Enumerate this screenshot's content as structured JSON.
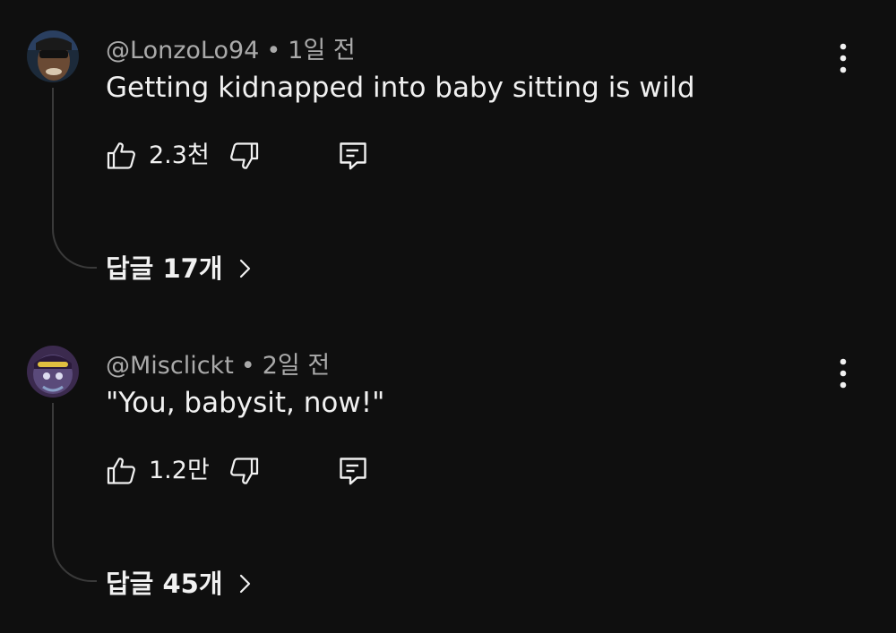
{
  "comments": [
    {
      "author": "@LonzoLo94",
      "separator": "•",
      "time": "1일 전",
      "text": "Getting kidnapped into baby sitting is wild",
      "likes": "2.3천",
      "replies_label": "답글 17개",
      "icons": {
        "like": "thumb-up-icon",
        "dislike": "thumb-down-icon",
        "reply": "comment-reply-icon",
        "more": "more-vert-icon",
        "chevron": "chevron-right-icon"
      }
    },
    {
      "author": "@Misclickt",
      "separator": "•",
      "time": "2일 전",
      "text": "\"You, babysit, now!\"",
      "likes": "1.2만",
      "replies_label": "답글 45개",
      "icons": {
        "like": "thumb-up-icon",
        "dislike": "thumb-down-icon",
        "reply": "comment-reply-icon",
        "more": "more-vert-icon",
        "chevron": "chevron-right-icon"
      }
    }
  ],
  "colors": {
    "background": "#0f0f0f",
    "primary_text": "#f1f1f1",
    "secondary_text": "#aaaaaa",
    "thread_line": "#3a3a3a"
  }
}
